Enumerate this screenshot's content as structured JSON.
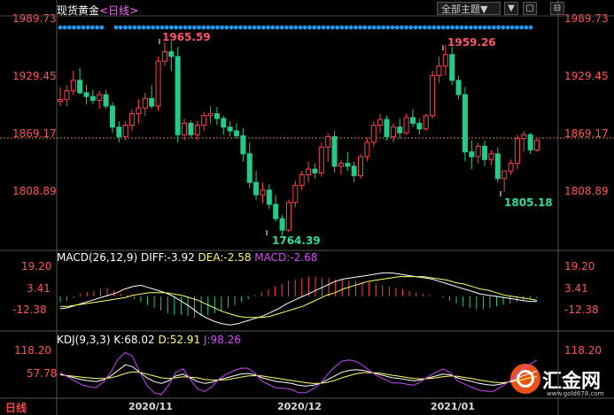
{
  "header": {
    "instrument": "现货黄金",
    "timeframe": "<日线>",
    "theme_label": "全部主题▼",
    "buttons": [
      "▼",
      "▢",
      "⊟"
    ]
  },
  "price_axis": {
    "ticks": [
      "1989.73",
      "1929.45",
      "1869.17",
      "1808.89"
    ],
    "tick_values": [
      1989.73,
      1929.45,
      1869.17,
      1808.89
    ],
    "current_price": 1864.5,
    "annotations": {
      "high1": "1965.59",
      "high2": "1959.26",
      "low1": "1764.39",
      "low2": "1805.18"
    }
  },
  "macd": {
    "label": "MACD(26,12,9)",
    "diff": "DIFF:-3.92",
    "dea": "DEA:-2.58",
    "macd": "MACD:-2.68",
    "ticks": [
      "19.20",
      "3.41",
      "-12.38"
    ]
  },
  "kdj": {
    "label": "KDJ(9,3,3)",
    "k": "K:68.02",
    "d": "D:52.91",
    "j": "J:98.26",
    "ticks": [
      "118.20",
      "57.78"
    ]
  },
  "dates": [
    "2020/11",
    "2020/12",
    "2021/01"
  ],
  "period_label": "日线",
  "logo": {
    "name": "汇金网",
    "url": "www.gold678.com"
  },
  "colors": {
    "up": "#ff4444",
    "down": "#22cc88",
    "axis": "#ff5555",
    "macd_diff": "#ffffff",
    "macd_dea": "#ffff66",
    "kdj_j": "#cc44ff"
  },
  "chart_data": {
    "type": "candlestick",
    "candles": [
      [
        1903,
        1918,
        1898,
        1905
      ],
      [
        1905,
        1920,
        1898,
        1914
      ],
      [
        1914,
        1935,
        1910,
        1925
      ],
      [
        1925,
        1938,
        1910,
        1912
      ],
      [
        1912,
        1920,
        1900,
        1908
      ],
      [
        1908,
        1915,
        1900,
        1904
      ],
      [
        1904,
        1914,
        1895,
        1910
      ],
      [
        1910,
        1915,
        1895,
        1898
      ],
      [
        1898,
        1902,
        1870,
        1876
      ],
      [
        1876,
        1882,
        1860,
        1866
      ],
      [
        1866,
        1882,
        1862,
        1878
      ],
      [
        1878,
        1895,
        1872,
        1890
      ],
      [
        1890,
        1905,
        1880,
        1896
      ],
      [
        1896,
        1912,
        1888,
        1906
      ],
      [
        1906,
        1920,
        1895,
        1898
      ],
      [
        1898,
        1950,
        1893,
        1945
      ],
      [
        1945,
        1965,
        1940,
        1955
      ],
      [
        1955,
        1966,
        1935,
        1950
      ],
      [
        1950,
        1960,
        1860,
        1868
      ],
      [
        1868,
        1885,
        1862,
        1880
      ],
      [
        1880,
        1883,
        1865,
        1868
      ],
      [
        1868,
        1882,
        1862,
        1878
      ],
      [
        1878,
        1892,
        1872,
        1888
      ],
      [
        1888,
        1898,
        1880,
        1890
      ],
      [
        1890,
        1897,
        1878,
        1885
      ],
      [
        1885,
        1888,
        1868,
        1876
      ],
      [
        1876,
        1882,
        1866,
        1872
      ],
      [
        1872,
        1880,
        1864,
        1867
      ],
      [
        1867,
        1875,
        1840,
        1848
      ],
      [
        1848,
        1860,
        1812,
        1818
      ],
      [
        1818,
        1830,
        1800,
        1805
      ],
      [
        1805,
        1818,
        1796,
        1810
      ],
      [
        1810,
        1816,
        1790,
        1795
      ],
      [
        1795,
        1805,
        1777,
        1780
      ],
      [
        1780,
        1784,
        1762,
        1768
      ],
      [
        1768,
        1800,
        1766,
        1797
      ],
      [
        1797,
        1820,
        1792,
        1815
      ],
      [
        1815,
        1830,
        1810,
        1826
      ],
      [
        1826,
        1840,
        1818,
        1832
      ],
      [
        1832,
        1838,
        1822,
        1828
      ],
      [
        1828,
        1860,
        1824,
        1855
      ],
      [
        1855,
        1870,
        1840,
        1866
      ],
      [
        1866,
        1872,
        1828,
        1835
      ],
      [
        1835,
        1842,
        1826,
        1838
      ],
      [
        1838,
        1850,
        1830,
        1835
      ],
      [
        1835,
        1840,
        1818,
        1825
      ],
      [
        1825,
        1848,
        1822,
        1845
      ],
      [
        1845,
        1865,
        1840,
        1860
      ],
      [
        1860,
        1882,
        1855,
        1878
      ],
      [
        1878,
        1890,
        1870,
        1884
      ],
      [
        1884,
        1888,
        1862,
        1866
      ],
      [
        1866,
        1880,
        1860,
        1876
      ],
      [
        1876,
        1885,
        1864,
        1870
      ],
      [
        1870,
        1890,
        1868,
        1886
      ],
      [
        1886,
        1895,
        1876,
        1880
      ],
      [
        1880,
        1885,
        1868,
        1874
      ],
      [
        1874,
        1890,
        1872,
        1888
      ],
      [
        1888,
        1935,
        1885,
        1930
      ],
      [
        1930,
        1950,
        1922,
        1940
      ],
      [
        1940,
        1962,
        1930,
        1952
      ],
      [
        1952,
        1960,
        1920,
        1925
      ],
      [
        1925,
        1930,
        1905,
        1910
      ],
      [
        1910,
        1918,
        1840,
        1850
      ],
      [
        1850,
        1862,
        1832,
        1845
      ],
      [
        1845,
        1860,
        1838,
        1856
      ],
      [
        1856,
        1862,
        1835,
        1842
      ],
      [
        1842,
        1852,
        1836,
        1848
      ],
      [
        1848,
        1855,
        1818,
        1822
      ],
      [
        1822,
        1830,
        1808,
        1830
      ],
      [
        1830,
        1842,
        1826,
        1838
      ],
      [
        1838,
        1868,
        1832,
        1864
      ],
      [
        1864,
        1872,
        1850,
        1868
      ],
      [
        1868,
        1870,
        1848,
        1852
      ],
      [
        1852,
        1865,
        1850,
        1862
      ]
    ],
    "macd_hist": [
      -4,
      -3,
      -1,
      2,
      3,
      4,
      5,
      6,
      4,
      2,
      1,
      -2,
      -4,
      -6,
      -8,
      -10,
      -12,
      -13,
      -13,
      -14,
      -15,
      -14,
      -13,
      -12,
      -10,
      -8,
      -6,
      -4,
      -2,
      1,
      3,
      5,
      7,
      9,
      11,
      12,
      13,
      14,
      14,
      13,
      13,
      12,
      12,
      11,
      11,
      10,
      10,
      9,
      8,
      7,
      6,
      5,
      4,
      3,
      2,
      1,
      0,
      -1,
      -3,
      -5,
      -7,
      -8,
      -9,
      -9,
      -8,
      -7,
      -6,
      -5,
      -4,
      -3,
      -2,
      -1
    ],
    "macd_diff": [
      -10,
      -9,
      -7,
      -5,
      -3,
      -1,
      1,
      3,
      6,
      8,
      9,
      7,
      5,
      3,
      0,
      -4,
      -8,
      -13,
      -17,
      -20,
      -22,
      -23,
      -22,
      -20,
      -18,
      -16,
      -13,
      -10,
      -6,
      -3,
      0,
      3,
      6,
      9,
      12,
      14,
      15,
      16,
      17,
      18,
      19,
      19,
      18,
      17,
      16,
      15,
      14,
      12,
      10,
      8,
      6,
      4,
      2,
      1,
      0,
      -1,
      -2,
      -3,
      -4,
      -4
    ],
    "macd_dea": [
      -8,
      -8,
      -7,
      -6,
      -5,
      -4,
      -3,
      -2,
      -1,
      1,
      2,
      3,
      3,
      3,
      2,
      1,
      -1,
      -3,
      -6,
      -9,
      -12,
      -14,
      -16,
      -17,
      -17,
      -17,
      -16,
      -14,
      -12,
      -10,
      -8,
      -5,
      -2,
      1,
      3,
      6,
      8,
      10,
      12,
      13,
      14,
      15,
      16,
      16,
      16,
      16,
      15,
      14,
      13,
      11,
      10,
      8,
      6,
      5,
      3,
      1,
      0,
      -1,
      -2,
      -3
    ],
    "kdj_k": [
      60,
      55,
      50,
      45,
      42,
      40,
      45,
      55,
      70,
      85,
      80,
      65,
      50,
      40,
      35,
      42,
      55,
      60,
      50,
      40,
      35,
      38,
      45,
      50,
      55,
      60,
      62,
      58,
      50,
      45,
      40,
      38,
      35,
      30,
      28,
      30,
      35,
      45,
      55,
      65,
      70,
      72,
      70,
      65,
      60,
      55,
      50,
      48,
      45,
      42,
      45,
      50,
      55,
      60,
      58,
      50,
      45,
      40,
      35,
      32,
      30,
      33,
      38,
      45,
      55,
      62,
      68
    ],
    "kdj_d": [
      58,
      56,
      54,
      52,
      50,
      48,
      48,
      50,
      55,
      62,
      66,
      65,
      60,
      55,
      50,
      48,
      50,
      53,
      52,
      50,
      46,
      44,
      44,
      45,
      48,
      52,
      55,
      56,
      55,
      52,
      49,
      46,
      43,
      40,
      37,
      35,
      35,
      38,
      43,
      50,
      56,
      61,
      64,
      64,
      63,
      60,
      57,
      54,
      51,
      48,
      47,
      48,
      50,
      53,
      55,
      54,
      51,
      48,
      44,
      41,
      38,
      37,
      38,
      41,
      45,
      50,
      53
    ],
    "kdj_j": [
      64,
      53,
      42,
      31,
      26,
      24,
      39,
      65,
      100,
      118,
      108,
      65,
      30,
      10,
      5,
      30,
      65,
      74,
      46,
      20,
      13,
      26,
      47,
      60,
      69,
      76,
      76,
      62,
      40,
      31,
      22,
      22,
      19,
      10,
      10,
      20,
      35,
      59,
      79,
      95,
      98,
      94,
      82,
      67,
      54,
      45,
      36,
      36,
      33,
      30,
      41,
      54,
      65,
      74,
      64,
      42,
      33,
      24,
      17,
      14,
      14,
      25,
      38,
      53,
      75,
      86,
      98
    ]
  }
}
